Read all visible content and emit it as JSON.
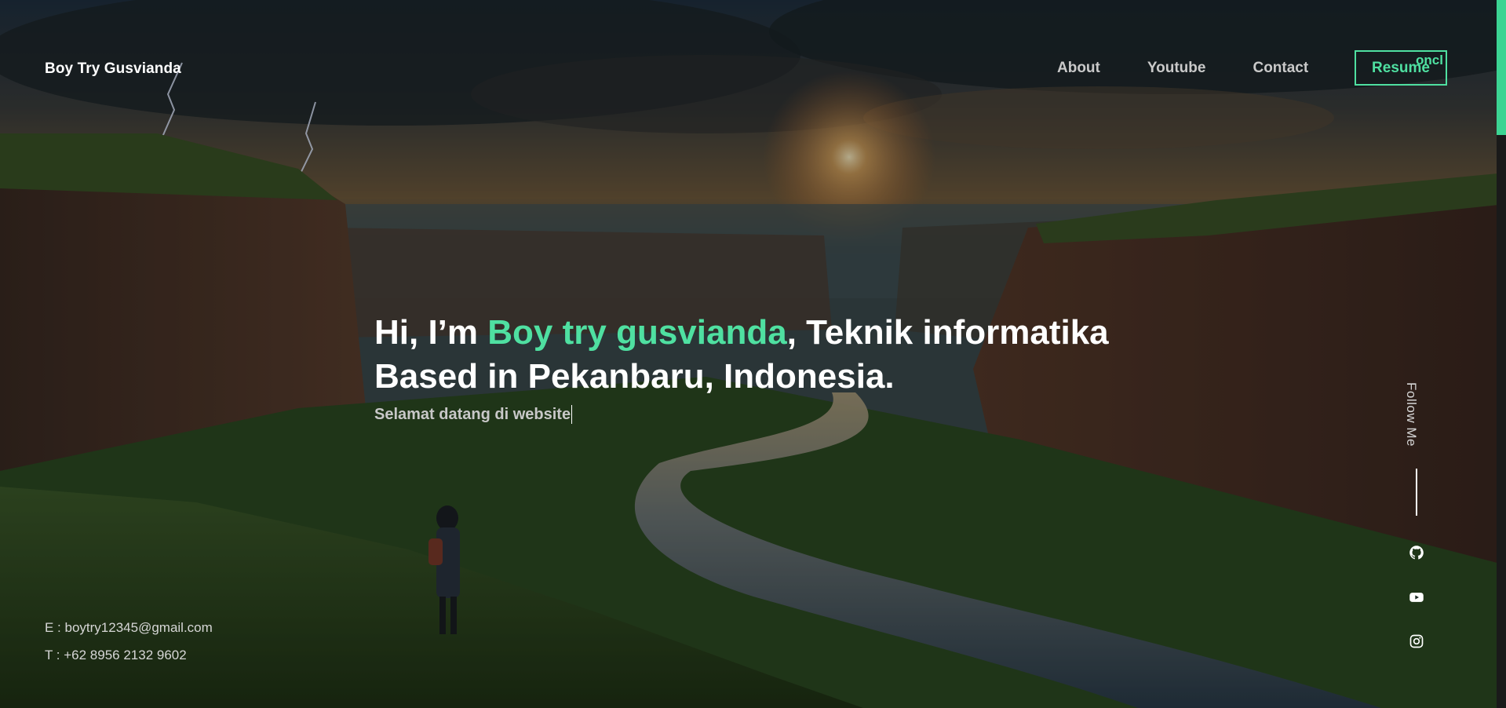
{
  "header": {
    "brand": "Boy Try Gusvianda",
    "nav": {
      "about": "About",
      "youtube": "Youtube",
      "contact": "Contact",
      "resume": "Resume",
      "resume_overlap": "oncl"
    }
  },
  "hero": {
    "greeting": "Hi, I’m ",
    "name": "Boy try gusvianda",
    "role": ", Teknik informatika",
    "line2": "Based in Pekanbaru, Indonesia.",
    "subtitle": "Selamat datang di website"
  },
  "contact": {
    "email": "E : boytry12345@gmail.com",
    "phone": "T : +62 8956 2132 9602"
  },
  "social": {
    "label": "Follow Me",
    "icons": [
      "github-icon",
      "youtube-icon",
      "instagram-icon"
    ]
  },
  "colors": {
    "accent": "#4fe0a1",
    "text": "#ffffff",
    "muted": "#c9c9c9"
  }
}
